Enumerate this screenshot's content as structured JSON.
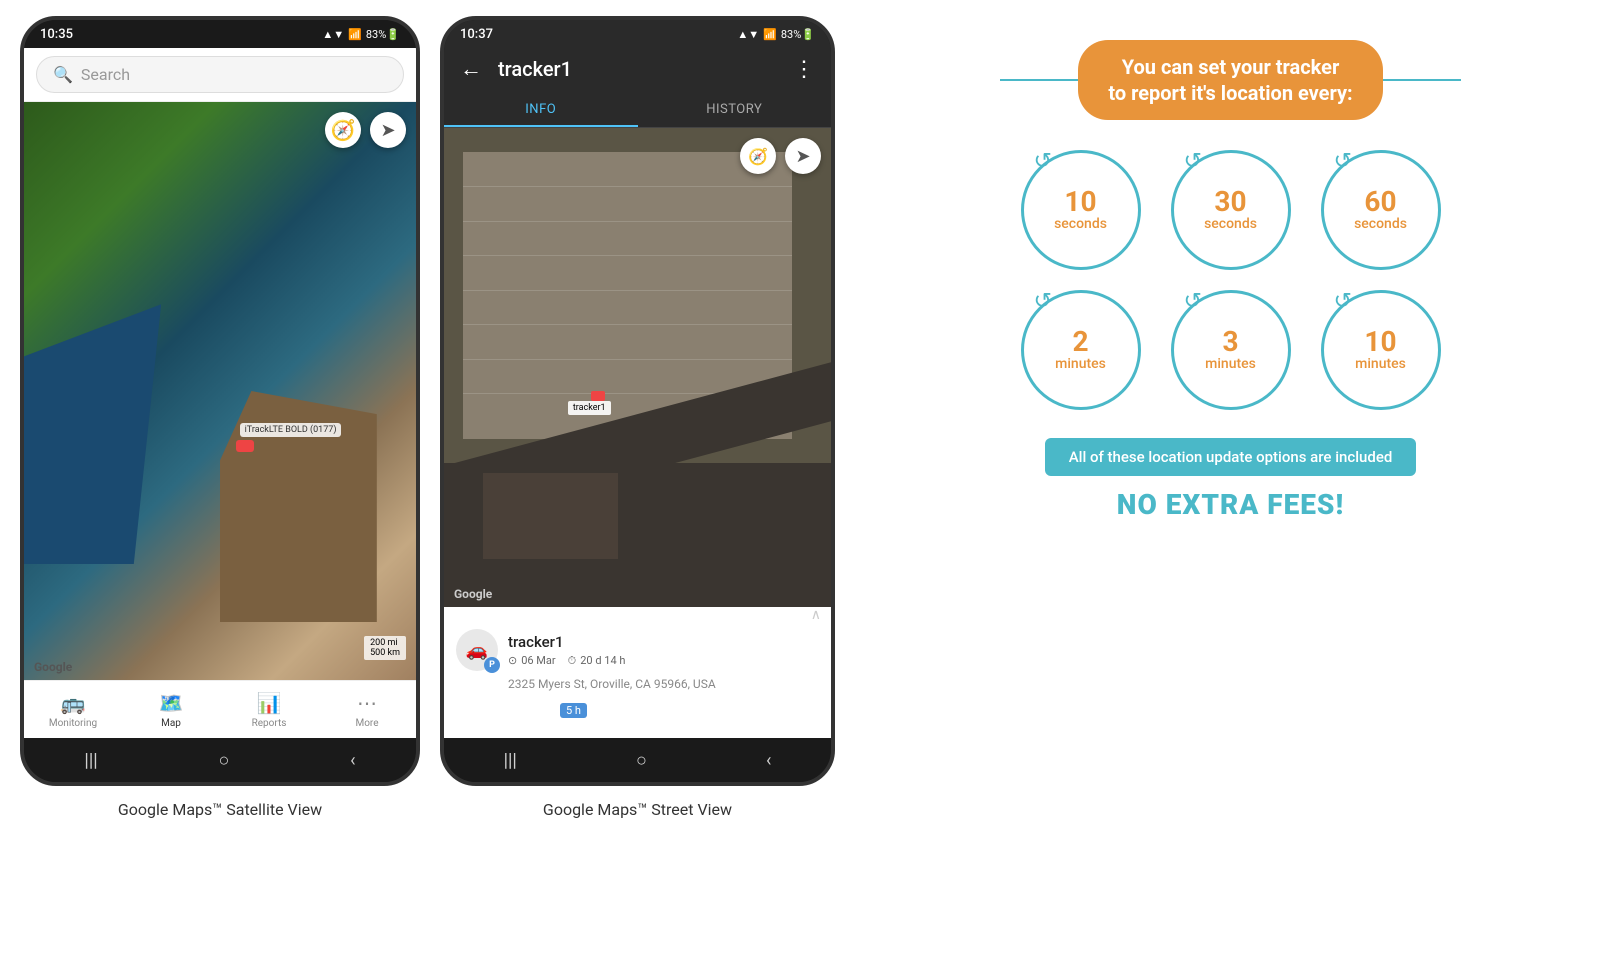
{
  "phones": {
    "left": {
      "status_time": "10:35",
      "status_signal": "▲▼ ıl 83%▪",
      "search_placeholder": "Search",
      "map_tracker_label": "iTrackLTE BOLD (0177)",
      "google_logo": "Google",
      "map_scale": "200 mi\n500 km",
      "nav_items": [
        {
          "label": "Monitoring",
          "icon": "🚌",
          "active": false
        },
        {
          "label": "Map",
          "icon": "⚐",
          "active": true
        },
        {
          "label": "Reports",
          "icon": "▦",
          "active": false
        },
        {
          "label": "More",
          "icon": "•••",
          "active": false
        }
      ],
      "caption": "Google Maps™ Satellite View"
    },
    "right": {
      "status_time": "10:37",
      "status_signal": "▲▼ ıl 83%▪",
      "tracker_name": "tracker1",
      "tabs": [
        {
          "label": "INFO",
          "active": true
        },
        {
          "label": "HISTORY",
          "active": false
        }
      ],
      "google_logo": "Google",
      "tracker_label": "tracker1",
      "info_panel": {
        "tracker_name": "tracker1",
        "parking_badge": "P",
        "date": "06 Mar",
        "duration": "20 d 14 h",
        "address": "2325 Myers St, Oroville, CA 95966, USA",
        "time_badge": "5 h"
      },
      "caption": "Google Maps™ Street View"
    }
  },
  "info_graphic": {
    "banner_text": "You can set your tracker\nto report it's location every:",
    "circles": [
      {
        "number": "10",
        "unit": "seconds"
      },
      {
        "number": "30",
        "unit": "seconds"
      },
      {
        "number": "60",
        "unit": "seconds"
      },
      {
        "number": "2",
        "unit": "minutes"
      },
      {
        "number": "3",
        "unit": "minutes"
      },
      {
        "number": "10",
        "unit": "minutes"
      }
    ],
    "included_text": "All of these location update options are included",
    "no_fees_text": "NO EXTRA FEES!"
  }
}
